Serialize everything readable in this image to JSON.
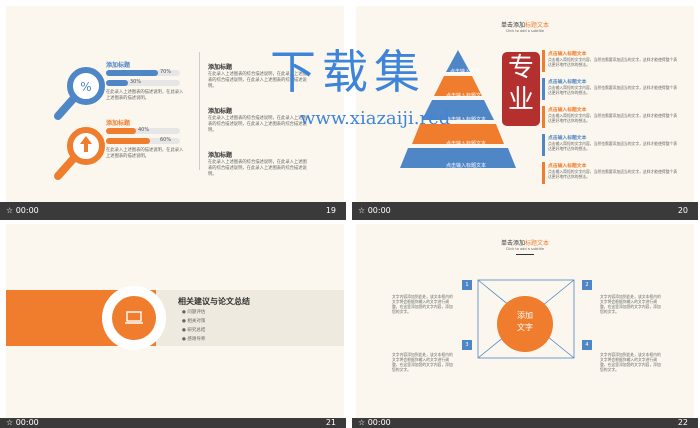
{
  "slides": [
    {
      "number": "19",
      "time": "00:00",
      "items": [
        {
          "title": "添加标题",
          "bar1_pct": "70%",
          "bar2_pct": "30%",
          "text": "在此录入上述图表的描述说明，在此录入上述图表的描述说明。"
        },
        {
          "title": "添加标题",
          "bar1_pct": "40%",
          "bar2_pct": "60%",
          "text": "在此录入上述图表的描述说明，在此录入上述图表的描述说明。"
        }
      ],
      "right_items": [
        {
          "title": "添加标题",
          "text": "在此录入上述图表的综合描述说明，在此录入上述图表的综合描述说明，在此录入上述图表的综合描述说明。"
        },
        {
          "title": "添加标题",
          "text": "在此录入上述图表的综合描述说明，在此录入上述图表的综合描述说明，在此录入上述图表的综合描述说明。"
        },
        {
          "title": "添加标题",
          "text": "在此录入上述图表的综合描述说明，在此录入上述图表的综合描述说明，在此录入上述图表的综合描述说明。"
        }
      ]
    },
    {
      "number": "20",
      "time": "00:00",
      "title_prefix": "单击添加",
      "title_highlight": "标题文本",
      "subtitle": "Click to add a subtitle",
      "pyramid": [
        "点击输入文本",
        "点击输入标题文本",
        "点击输入标题文本",
        "点击输入标题文本",
        "点击输入标题文本"
      ],
      "list_items": [
        {
          "title": "点击输入标题文本",
          "text": "点击输入简短的文字内容，当然也需要添加适当的文字，这样才能使得整个表达更好地传达你的想法。"
        },
        {
          "title": "点击输入标题文本",
          "text": "点击输入简短的文字内容，当然也需要添加适当的文字，这样才能使得整个表达更好地传达你的想法。"
        },
        {
          "title": "点击输入标题文本",
          "text": "点击输入简短的文字内容，当然也需要添加适当的文字，这样才能使得整个表达更好地传达你的想法。"
        },
        {
          "title": "点击输入标题文本",
          "text": "点击输入简短的文字内容，当然也需要添加适当的文字，这样才能使得整个表达更好地传达你的想法。"
        },
        {
          "title": "点击输入标题文本",
          "text": "点击输入简短的文字内容，当然也需要添加适当的文字，这样才能使得整个表达更好地传达你的想法。"
        }
      ]
    },
    {
      "number": "21",
      "time": "00:00",
      "section_title": "相关建议与论文总结",
      "bullets": [
        "问题评估",
        "相关对策",
        "研究总结",
        "感谢导师"
      ]
    },
    {
      "number": "22",
      "time": "00:00",
      "title_prefix": "单击添加",
      "title_highlight": "标题文本",
      "subtitle": "Click to add a subtitle",
      "center_text_1": "添加",
      "center_text_2": "文字",
      "boxes": [
        "1",
        "2",
        "3",
        "4"
      ],
      "texts": [
        "文字内容添加到此处，该文本框内的文字将会根据你输入的文字进行调整，在这里添加您的文字内容，添加您的文字。",
        "文字内容添加到此处，该文本框内的文字将会根据你输入的文字进行调整，在这里添加您的文字内容，添加您的文字。",
        "文字内容添加到此处，该文本框内的文字将会根据你输入的文字进行调整，在这里添加您的文字内容，添加您的文字。",
        "文字内容添加到此处，该文本框内的文字将会根据你输入的文字进行调整，在这里添加您的文字内容，添加您的文字。"
      ]
    }
  ],
  "watermark": {
    "cn": "下载集",
    "url": "www.xiazaiji.red",
    "seal": [
      "专",
      "业"
    ]
  },
  "colors": {
    "blue": "#4f86c6",
    "orange": "#ef7d2d",
    "background": "#fbf7ee",
    "bar": "#3a3a3a"
  }
}
